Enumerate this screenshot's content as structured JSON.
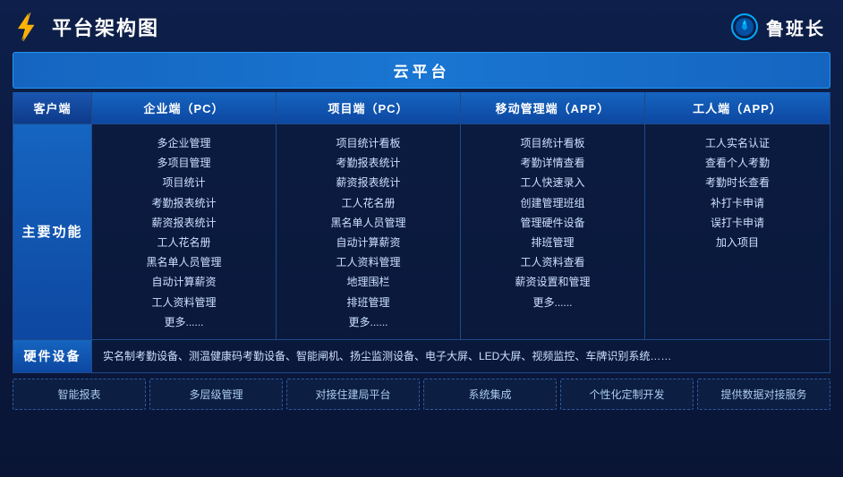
{
  "header": {
    "title": "平台架构图",
    "brand": "鲁班长"
  },
  "cloud_banner": "云平台",
  "columns": {
    "client": "客户端",
    "enterprise_pc": "企业端（PC）",
    "project_pc": "项目端（PC）",
    "mobile_app": "移动管理端（APP）",
    "worker_app": "工人端（APP）"
  },
  "main_feature_label": "主要功能",
  "enterprise_features": [
    "多企业管理",
    "多项目管理",
    "项目统计",
    "考勤报表统计",
    "薪资报表统计",
    "工人花名册",
    "黑名单人员管理",
    "自动计算薪资",
    "工人资料管理",
    "更多......"
  ],
  "project_features": [
    "项目统计看板",
    "考勤报表统计",
    "薪资报表统计",
    "工人花名册",
    "黑名单人员管理",
    "自动计算薪资",
    "工人资料管理",
    "地理围栏",
    "排班管理",
    "更多......"
  ],
  "mobile_features": [
    "项目统计看板",
    "考勤详情查看",
    "工人快速录入",
    "创建管理班组",
    "管理硬件设备",
    "排班管理",
    "工人资料查看",
    "薪资设置和管理",
    "更多......"
  ],
  "worker_features": [
    "工人实名认证",
    "查看个人考勤",
    "考勤时长查看",
    "补打卡申请",
    "误打卡申请",
    "加入项目"
  ],
  "hardware_label": "硬件设备",
  "hardware_content": "实名制考勤设备、测温健康码考勤设备、智能闸机、扬尘监测设备、电子大屏、LED大屏、视频监控、车牌识别系统……",
  "bottom_items": [
    "智能报表",
    "多层级管理",
    "对接住建局平台",
    "系统集成",
    "个性化定制开发",
    "提供数据对接服务"
  ]
}
